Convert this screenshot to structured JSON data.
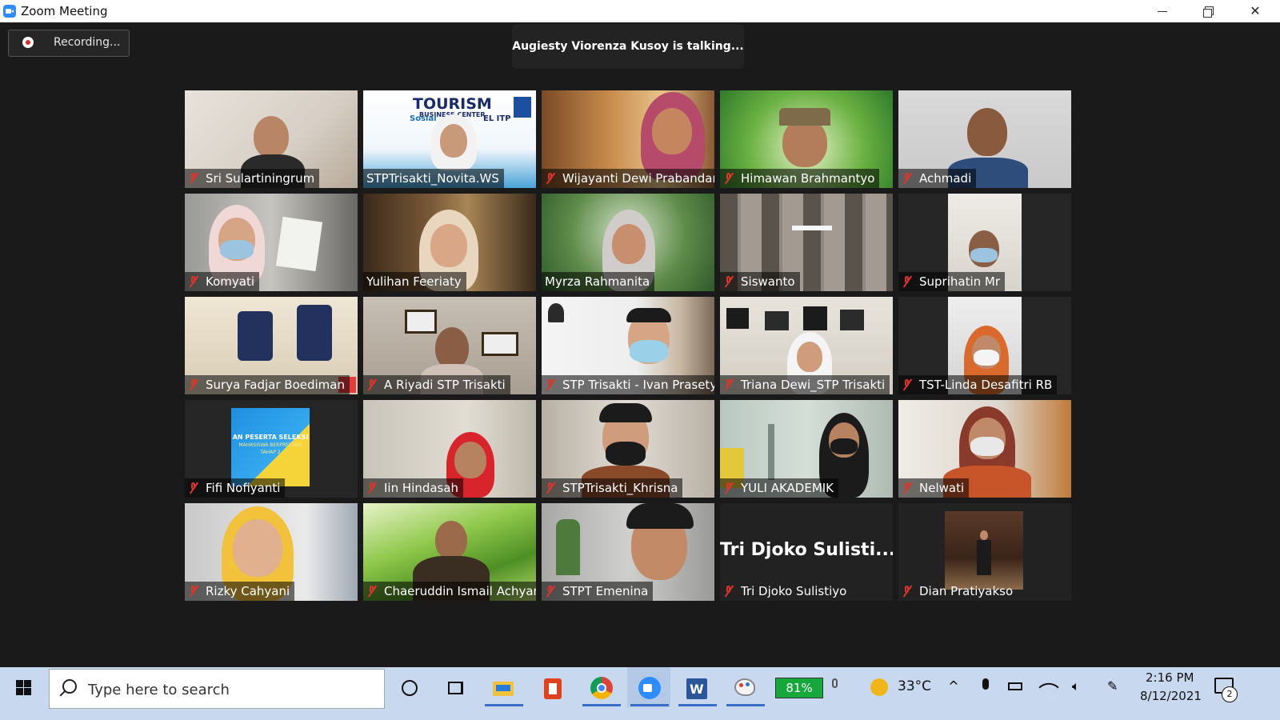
{
  "window": {
    "title": "Zoom Meeting"
  },
  "meeting": {
    "recording_label": "Recording...",
    "talking_banner": "Augiesty Viorenza Kusoy is talking..."
  },
  "participants": [
    {
      "name": "Sri Sulartiningrum",
      "muted": true
    },
    {
      "name": "STPTrisakti_Novita.WS",
      "muted": false
    },
    {
      "name": "Wijayanti Dewi Prabandari",
      "muted": true
    },
    {
      "name": "Himawan Brahmantyo",
      "muted": true
    },
    {
      "name": "Achmadi",
      "muted": true
    },
    {
      "name": "Komyati",
      "muted": true
    },
    {
      "name": "Yulihan Feeriaty",
      "muted": false
    },
    {
      "name": "Myrza Rahmanita",
      "muted": false
    },
    {
      "name": "Siswanto",
      "muted": true
    },
    {
      "name": "Suprihatin Mr",
      "muted": true
    },
    {
      "name": "Surya Fadjar Boediman",
      "muted": true
    },
    {
      "name": "A Riyadi STP Trisakti",
      "muted": true
    },
    {
      "name": "STP Trisakti - Ivan Prasetya",
      "muted": true
    },
    {
      "name": "Triana Dewi_STP Trisakti",
      "muted": true
    },
    {
      "name": "TST-Linda Desafitri RB",
      "muted": true
    },
    {
      "name": "Fifi Nofiyanti",
      "muted": true
    },
    {
      "name": "Iin Hindasah",
      "muted": true
    },
    {
      "name": "STPTrisakti_Khrisna",
      "muted": true
    },
    {
      "name": "YULI AKADEMIK",
      "muted": true
    },
    {
      "name": "Nelwati",
      "muted": true
    },
    {
      "name": "Rizky Cahyani",
      "muted": true
    },
    {
      "name": "Chaeruddin Ismail Achyar",
      "muted": true
    },
    {
      "name": "STPT Emenina",
      "muted": true
    },
    {
      "name": "Tri Djoko Sulistiyo",
      "muted": true,
      "video_off_text": "Tri Djoko Sulisti..."
    },
    {
      "name": "Dian Pratiyakso",
      "muted": true
    }
  ],
  "tile_text": {
    "tourism_banner": "TOURISM",
    "tourism_sub": "BUSINESS CENTER",
    "tourism_left": "Sosial",
    "tourism_right": "EL ITP",
    "slide_text": "AN PESERTA SELEKSI",
    "slide_sub": "MAHASISWA BERPRESTASI",
    "slide_sub2": "TAHAP 2"
  },
  "taskbar": {
    "search_placeholder": "Type here to search",
    "battery": "81%",
    "temperature": "33°C",
    "time": "2:16 PM",
    "date": "8/12/2021",
    "notification_count": "2"
  },
  "colors": {
    "accent": "#2d8cff",
    "muted_icon": "#e0342b",
    "taskbar": "#c8d8ee"
  }
}
